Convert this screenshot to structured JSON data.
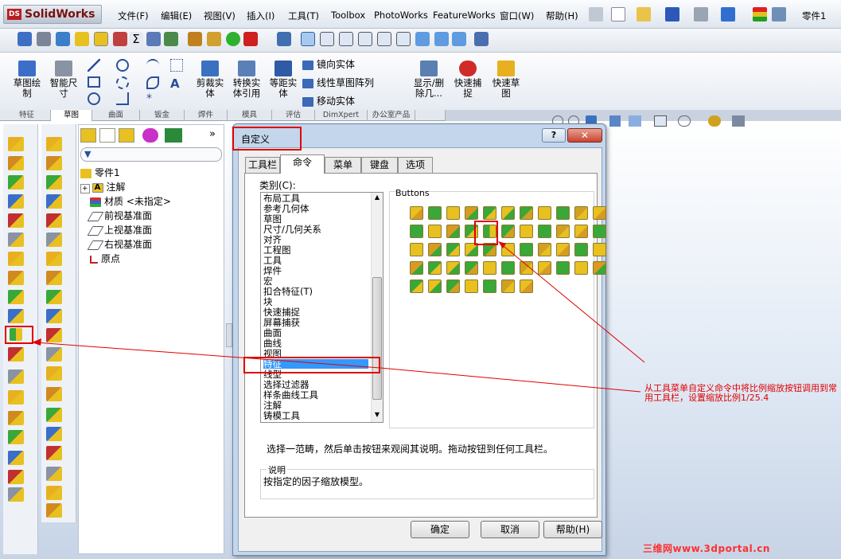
{
  "app": {
    "logo_text": "SolidWorks",
    "logo_mark": "DS",
    "doc_title": "零件1"
  },
  "menu": [
    "文件(F)",
    "编辑(E)",
    "视图(V)",
    "插入(I)",
    "工具(T)",
    "Toolbox",
    "PhotoWorks",
    "FeatureWorks",
    "窗口(W)",
    "帮助(H)"
  ],
  "cmd": {
    "sketch": "草图绘\n制",
    "smart_dim": "智能尺\n寸",
    "trim": "剪裁实\n体",
    "convert": "转换实\n体引用",
    "offset": "等距实\n体",
    "mirror": "镜向实体",
    "linear_pattern": "线性草图阵列",
    "move": "移动实体",
    "display_del": "显示/删\n除几...",
    "quick_snap": "快速捕\n捉",
    "quick_sketch": "快速草\n图"
  },
  "tabs": [
    "特征",
    "草图",
    "曲面",
    "钣金",
    "焊件",
    "模具",
    "评估",
    "DimXpert",
    "办公室产品",
    ""
  ],
  "active_tab": 1,
  "tree": {
    "root": "零件1",
    "items": [
      "注解",
      "材质 <未指定>",
      "前视基准面",
      "上视基准面",
      "右视基准面",
      "原点"
    ]
  },
  "dialog": {
    "title": "自定义",
    "help": "?",
    "close": "✕",
    "tabs": [
      "工具栏",
      "命令",
      "菜单",
      "键盘",
      "选项"
    ],
    "active_tab": 1,
    "category_label": "类别(C):",
    "categories": [
      "布局工具",
      "参考几何体",
      "草图",
      "尺寸/几何关系",
      "对齐",
      "工程图",
      "工具",
      "焊件",
      "宏",
      "扣合特征(T)",
      "块",
      "快速捕捉",
      "屏幕捕获",
      "曲面",
      "曲线",
      "视图",
      "特征",
      "线型",
      "选择过滤器",
      "样条曲线工具",
      "注解",
      "铸模工具"
    ],
    "selected_category": 16,
    "buttons_label": "Buttons",
    "instruction": "选择一范畴，然后单击按钮来观阅其说明。拖动按钮到任何工具栏。",
    "desc_label": "说明",
    "desc_text": "按指定的因子缩放模型。",
    "ok": "确定",
    "cancel": "取消",
    "help_btn": "帮助(H)"
  },
  "annotation": "从工具菜单自定义命令中将比例缩放按钮调用到常用工具栏，设置缩放比例1/25.4",
  "watermark": "三维网www.3dportal.cn",
  "colors": {
    "highlight": "#e00000",
    "selection": "#3399ff",
    "icon_yellow": "#e8c020",
    "icon_green": "#38a838"
  }
}
